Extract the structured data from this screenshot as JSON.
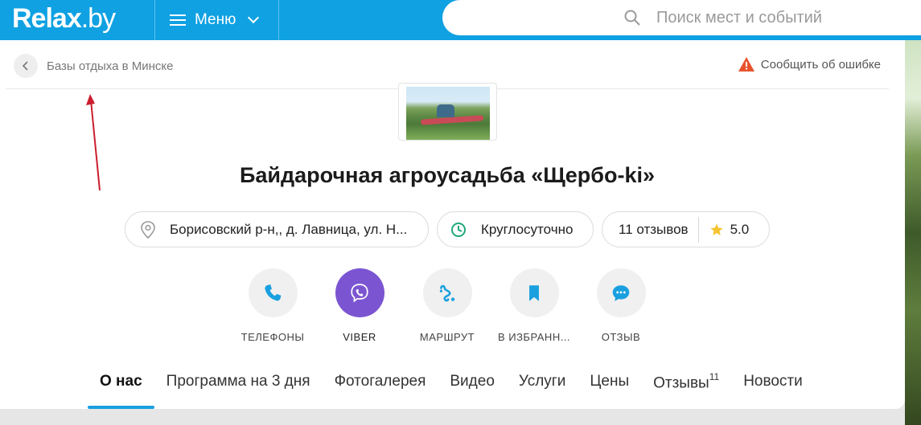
{
  "header": {
    "logo_text": "Relax",
    "logo_suffix": ".by",
    "menu_label": "Меню",
    "search_placeholder": "Поиск мест и событий"
  },
  "breadcrumb": {
    "label": "Базы отдыха в Минске"
  },
  "report_label": "Сообщить об ошибке",
  "title": "Байдарочная агроусадьба «Щербо-ki»",
  "info": {
    "address": "Борисовский р-н,, д. Лавница, ул. Н...",
    "hours": "Круглосуточно",
    "reviews": "11 отзывов",
    "rating": "5.0"
  },
  "actions": [
    {
      "label": "ТЕЛЕФОНЫ",
      "icon": "phone-icon"
    },
    {
      "label": "VIBER",
      "icon": "viber-icon"
    },
    {
      "label": "МАРШРУТ",
      "icon": "route-icon"
    },
    {
      "label": "В ИЗБРАНН...",
      "icon": "bookmark-icon"
    },
    {
      "label": "ОТЗЫВ",
      "icon": "comment-icon"
    }
  ],
  "tabs": [
    {
      "label": "О нас",
      "active": true
    },
    {
      "label": "Программа на 3 дня"
    },
    {
      "label": "Фотогалерея"
    },
    {
      "label": "Видео"
    },
    {
      "label": "Услуги"
    },
    {
      "label": "Цены"
    },
    {
      "label": "Отзывы",
      "badge": "11"
    },
    {
      "label": "Новости"
    }
  ],
  "colors": {
    "brand": "#0fa1e2",
    "viber": "#7b55d1",
    "accent_icon": "#1aa0df",
    "warning": "#e8532c",
    "star": "#f4c430",
    "annotation_arrow": "#cc1e2e"
  }
}
